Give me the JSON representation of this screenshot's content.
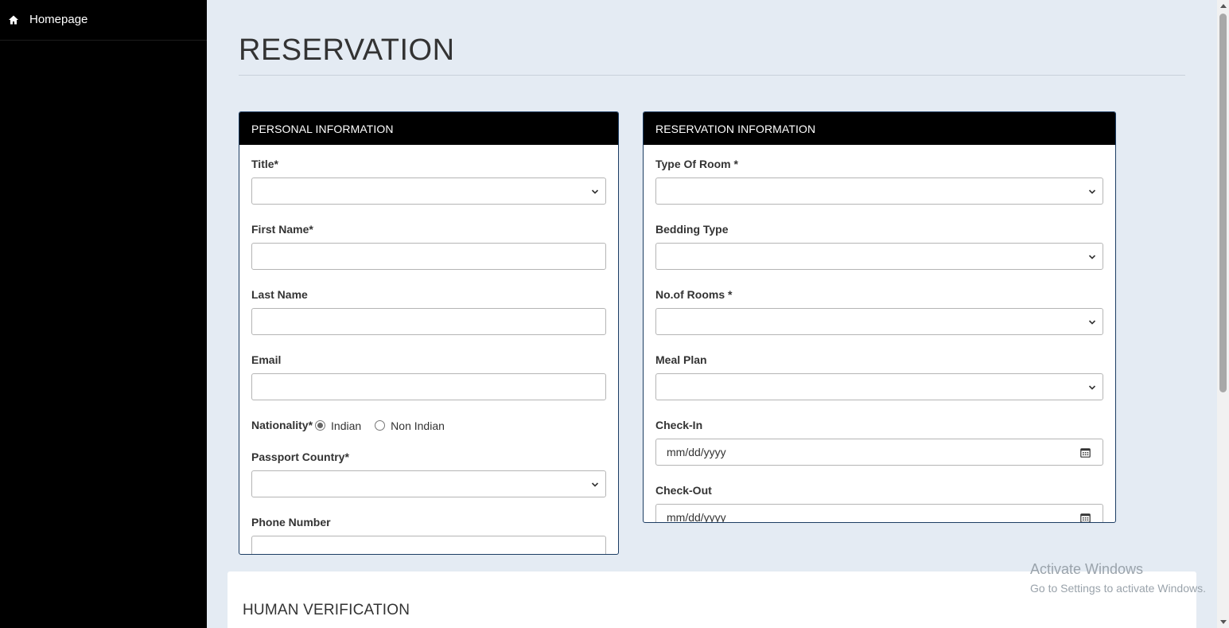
{
  "sidebar": {
    "items": [
      {
        "label": "Homepage",
        "icon": "home-icon"
      }
    ]
  },
  "page": {
    "title": "RESERVATION"
  },
  "personal": {
    "header": "PERSONAL INFORMATION",
    "title_label": "Title*",
    "title_value": "",
    "first_name_label": "First Name*",
    "first_name_value": "",
    "last_name_label": "Last Name",
    "last_name_value": "",
    "email_label": "Email",
    "email_value": "",
    "nationality_label": "Nationality*",
    "nationality_options": [
      "Indian",
      "Non Indian"
    ],
    "nationality_selected": "Indian",
    "passport_label": "Passport Country*",
    "passport_value": "",
    "phone_label": "Phone Number",
    "phone_value": ""
  },
  "reservation": {
    "header": "RESERVATION INFORMATION",
    "room_type_label": "Type Of Room *",
    "room_type_value": "",
    "bedding_label": "Bedding Type",
    "bedding_value": "",
    "rooms_label": "No.of Rooms *",
    "rooms_value": "",
    "meal_label": "Meal Plan",
    "meal_value": "",
    "checkin_label": "Check-In",
    "checkin_placeholder": "mm/dd/yyyy",
    "checkout_label": "Check-Out",
    "checkout_placeholder": "mm/dd/yyyy"
  },
  "verification": {
    "title": "HUMAN VERIFICATION"
  },
  "watermark": {
    "line1": "Activate Windows",
    "line2": "Go to Settings to activate Windows."
  },
  "colors": {
    "sidebar_bg": "#000000",
    "page_bg": "#e4ebf3",
    "panel_border": "#1c3d63",
    "panel_header_bg": "#000000"
  }
}
